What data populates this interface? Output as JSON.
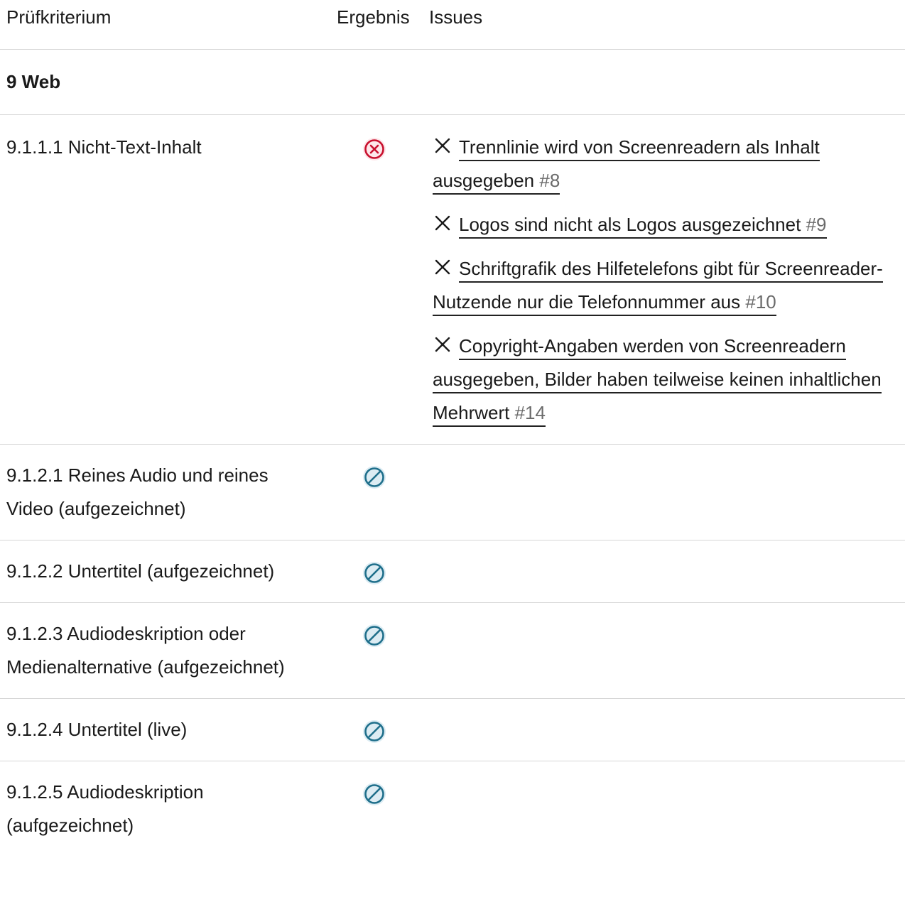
{
  "header": {
    "criterion": "Prüfkriterium",
    "result": "Ergebnis",
    "issues": "Issues"
  },
  "section": {
    "title": "9 Web"
  },
  "rows": [
    {
      "criterion": "9.1.1.1 Nicht-Text-Inhalt",
      "result": "failed",
      "result_icon": "circle-x-icon",
      "issues": [
        {
          "text": "Trennlinie wird von Screenreadern als Inhalt ausgegeben",
          "number": "#8"
        },
        {
          "text": "Logos sind nicht als Logos ausgezeichnet",
          "number": "#9"
        },
        {
          "text": "Schriftgrafik des Hilfetelefons gibt für Screenreader-Nutzende nur die Telefonnummer aus",
          "number": "#10"
        },
        {
          "text": "Copyright-Angaben werden von Screenreadern ausgegeben, Bilder haben teilweise keinen inhaltlichen Mehrwert",
          "number": "#14"
        }
      ]
    },
    {
      "criterion": "9.1.2.1 Reines Audio und reines Video (aufgezeichnet)",
      "result": "not-applicable",
      "result_icon": "circle-slash-icon"
    },
    {
      "criterion": "9.1.2.2 Untertitel (aufgezeichnet)",
      "result": "not-applicable",
      "result_icon": "circle-slash-icon"
    },
    {
      "criterion": "9.1.2.3 Audiodeskription oder Medienalternative (aufgezeichnet)",
      "result": "not-applicable",
      "result_icon": "circle-slash-icon"
    },
    {
      "criterion": "9.1.2.4 Untertitel (live)",
      "result": "not-applicable",
      "result_icon": "circle-slash-icon"
    },
    {
      "criterion": "9.1.2.5 Audiodeskription (aufgezeichnet)",
      "result": "not-applicable",
      "result_icon": "circle-slash-icon"
    }
  ],
  "colors": {
    "fail": "#c8102e",
    "fail_bg": "#fde7ea",
    "na": "#1f6f8b",
    "na_bg": "#dcecf3",
    "divider": "#d6d6d6",
    "issue_number": "#6b6b6b"
  }
}
